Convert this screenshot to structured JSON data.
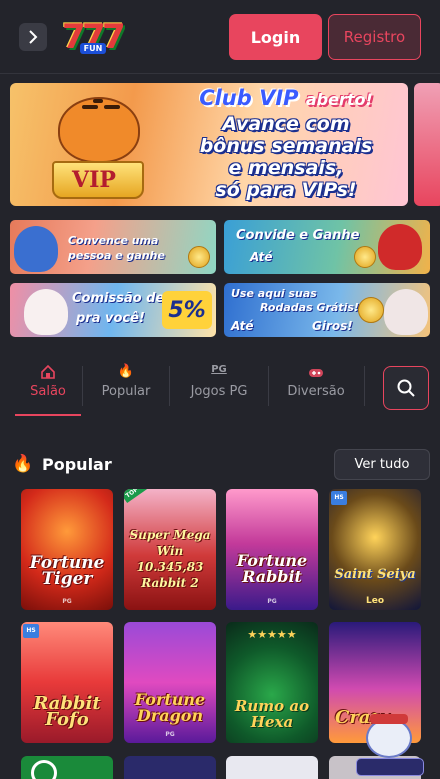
{
  "header": {
    "logo_text": "7",
    "logo_sub": "FUN",
    "login_label": "Login",
    "register_label": "Registro"
  },
  "hero": {
    "title": "Club VIP",
    "title_accent": "aberto!",
    "line1": "Avance com",
    "line2": "bônus semanais",
    "line3": "e mensais,",
    "line4": "só para VIPs!",
    "crown_text": "VIP"
  },
  "promos": [
    {
      "line1": "Convence uma",
      "line2": "pessoa e ganhe"
    },
    {
      "line1": "Convide e Ganhe",
      "line2": "Até"
    },
    {
      "line1": "Comissão de",
      "line2": "pra você!",
      "percent": "5%"
    },
    {
      "line1": "Use aqui suas",
      "line2": "Rodadas Grátis!",
      "line3": "Até",
      "line4": "Giros!"
    }
  ],
  "tabs": [
    {
      "label": "Salão",
      "icon": "home-icon",
      "active": true
    },
    {
      "label": "Popular",
      "icon": "flame-icon"
    },
    {
      "label": "Jogos PG",
      "icon": "pg-icon",
      "icon_text": "PG"
    },
    {
      "label": "Diversão",
      "icon": "gamepad-icon"
    }
  ],
  "section": {
    "title": "Popular",
    "see_all_label": "Ver tudo"
  },
  "games": [
    {
      "name": "Fortune Tiger",
      "brand": "PG"
    },
    {
      "name": "Super Mega Win 10.345,83 Rabbit 2",
      "badge": "TOP 1"
    },
    {
      "name": "Fortune Rabbit",
      "brand": "PG"
    },
    {
      "name": "Saint Seiya",
      "sub": "Leo",
      "badge": "HS"
    },
    {
      "name": "Rabbit Fofo",
      "badge": "HS"
    },
    {
      "name": "Fortune Dragon",
      "brand": "PG"
    },
    {
      "name": "Rumo ao Hexa"
    },
    {
      "name": "Crazy"
    }
  ],
  "colors": {
    "background": "#23242b",
    "accent": "#e8455e",
    "tab_inactive": "#9a9ba3"
  }
}
